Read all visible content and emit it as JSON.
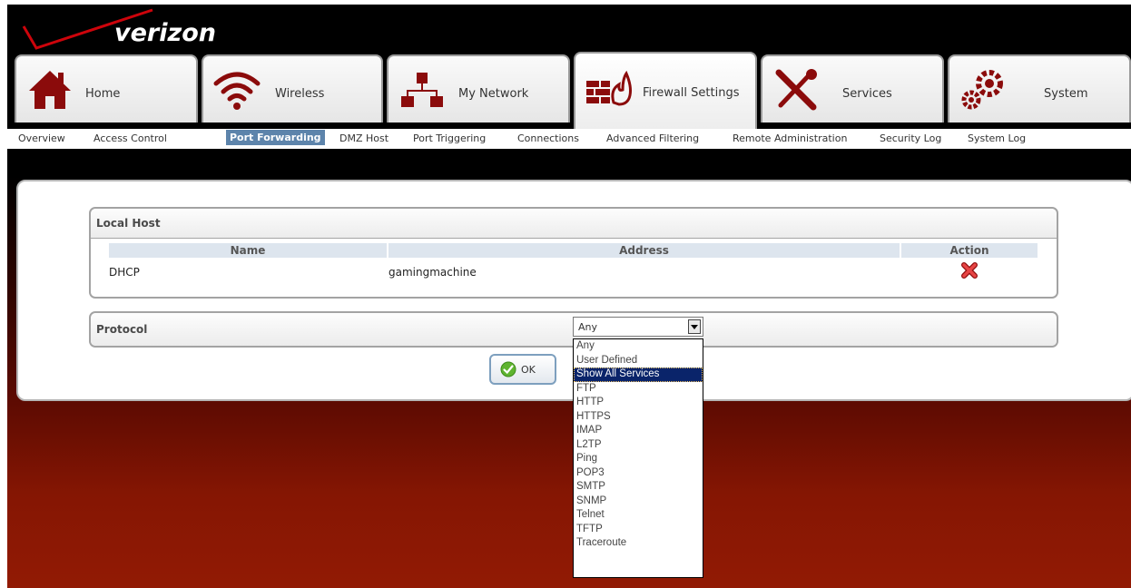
{
  "header": {
    "logo_text": "verizon"
  },
  "tabs": [
    {
      "label": "Home",
      "icon": "home-icon"
    },
    {
      "label": "Wireless",
      "icon": "wireless-icon"
    },
    {
      "label": "My Network",
      "icon": "network-icon"
    },
    {
      "label": "Firewall Settings",
      "icon": "firewall-icon",
      "active": true
    },
    {
      "label": "Services",
      "icon": "tools-icon"
    },
    {
      "label": "System",
      "icon": "gears-icon"
    }
  ],
  "subnav": [
    "Overview",
    "Access Control",
    "Port Forwarding",
    "DMZ Host",
    "Port Triggering",
    "Connections",
    "Advanced Filtering",
    "Remote Administration",
    "Security Log",
    "System Log"
  ],
  "subnav_active": "Port Forwarding",
  "local_host": {
    "title": "Local Host",
    "columns": [
      "Name",
      "Address",
      "Action"
    ],
    "rows": [
      {
        "name": "DHCP",
        "address": "gamingmachine",
        "action_icon": "delete-x-icon"
      }
    ]
  },
  "protocol": {
    "label": "Protocol",
    "selected": "Any",
    "options": [
      "Any",
      "User Defined",
      "Show All Services",
      "FTP",
      "HTTP",
      "HTTPS",
      "IMAP",
      "L2TP",
      "Ping",
      "POP3",
      "SMTP",
      "SNMP",
      "Telnet",
      "TFTP",
      "Traceroute"
    ],
    "highlighted": "Show All Services"
  },
  "buttons": {
    "ok_label": "OK"
  },
  "colors": {
    "brand_red": "#cd040b",
    "subnav_active": "#5d84ab",
    "dropdown_highlight": "#0a246a"
  }
}
